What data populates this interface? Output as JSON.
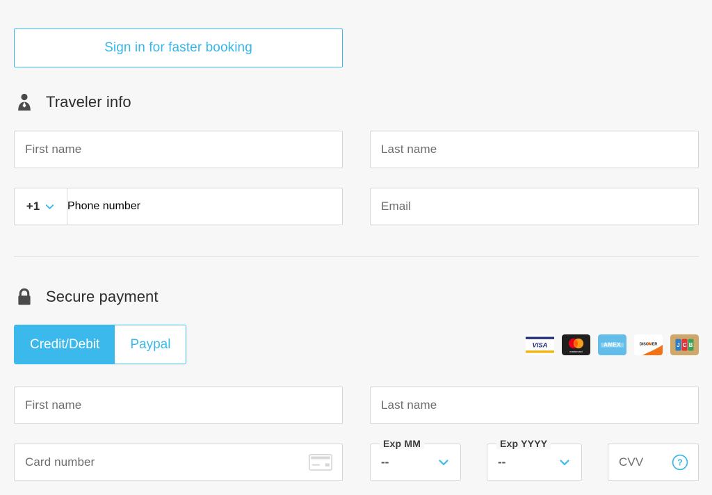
{
  "signin": {
    "label": "Sign in for faster booking"
  },
  "traveler": {
    "icon": "person-icon",
    "title": "Traveler info",
    "fields": {
      "first_name_placeholder": "First name",
      "last_name_placeholder": "Last name",
      "country_code": "+1",
      "phone_placeholder": "Phone number",
      "email_placeholder": "Email"
    }
  },
  "payment": {
    "icon": "lock-icon",
    "title": "Secure payment",
    "tabs": [
      {
        "label": "Credit/Debit",
        "active": true
      },
      {
        "label": "Paypal",
        "active": false
      }
    ],
    "brands": [
      {
        "name": "visa",
        "label": "VISA"
      },
      {
        "name": "mastercard",
        "label": "mastercard"
      },
      {
        "name": "amex",
        "label": "AMEX"
      },
      {
        "name": "discover",
        "label": "DISC VER"
      },
      {
        "name": "jcb",
        "label": "JCB"
      }
    ],
    "fields": {
      "first_name_placeholder": "First name",
      "last_name_placeholder": "Last name",
      "card_number_placeholder": "Card number",
      "exp_month_label": "Exp MM",
      "exp_month_value": "--",
      "exp_year_label": "Exp YYYY",
      "exp_year_value": "--",
      "cvv_placeholder": "CVV",
      "cvv_help": "?"
    }
  },
  "colors": {
    "accent": "#3bb9ec",
    "page_bg": "#f7f7f7",
    "field_border": "#d6d6d6",
    "text": "#2d2d2d",
    "placeholder": "#6e6e6e"
  }
}
